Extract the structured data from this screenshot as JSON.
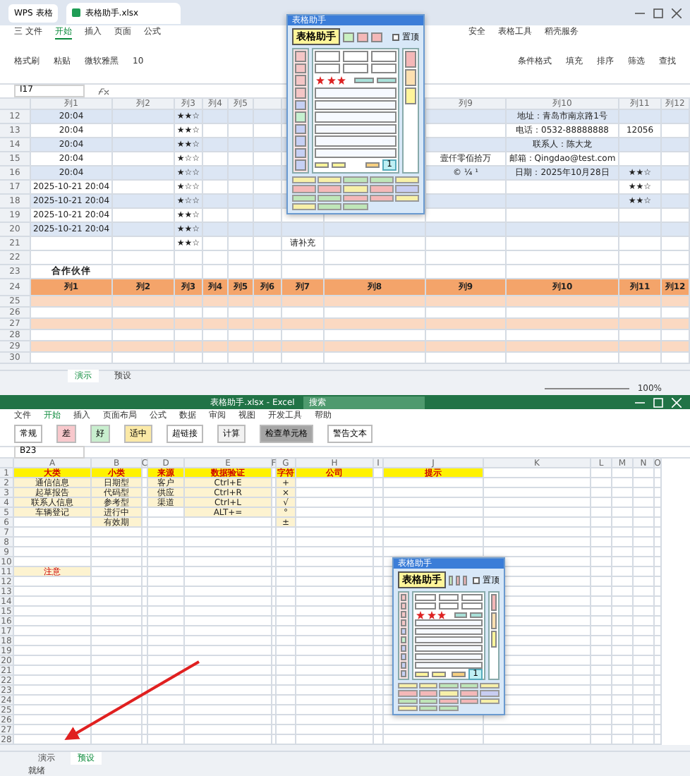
{
  "top_window": {
    "app_tab": "WPS 表格",
    "doc_tab": "表格助手.xlsx",
    "menu": [
      {
        "label": "三 文件",
        "selected": false
      },
      {
        "label": "开始",
        "selected": true
      },
      {
        "label": "插入",
        "selected": false
      },
      {
        "label": "页面",
        "selected": false
      },
      {
        "label": "公式",
        "selected": false
      }
    ],
    "menu_right": [
      {
        "label": "安全",
        "selected": false
      },
      {
        "label": "表格工具",
        "selected": false
      },
      {
        "label": "稻壳服务",
        "selected": false
      }
    ],
    "ribbon": [
      "格式刷",
      "粘贴",
      "微软雅黑",
      "10"
    ],
    "ribbon_right": [
      "条件格式",
      "填充",
      "排序",
      "筛选",
      "查找"
    ],
    "name_box": "I17",
    "columns": {
      "c1": "列1",
      "c2": "列2",
      "c3": "列3",
      "c4": "列4",
      "c5": "列5",
      "c9": "列9",
      "c10": "列10",
      "c11": "列11",
      "c12": "列12"
    },
    "rows": [
      {
        "num": "12",
        "cells": {
          "c1": "20:04",
          "c3": "★★☆",
          "c10": "地址：青岛市南京路1号"
        }
      },
      {
        "num": "13",
        "cells": {
          "c1": "20:04",
          "c3": "★★☆",
          "c10": "电话：0532-88888888",
          "c11": "12056"
        }
      },
      {
        "num": "14",
        "cells": {
          "c1": "20:04",
          "c3": "★★☆",
          "c10": "联系人：陈大龙"
        }
      },
      {
        "num": "15",
        "cells": {
          "c1": "20:04",
          "c3": "★☆☆",
          "c9": "壹仟零佰拾万",
          "c10": "邮箱：Qingdao@test.com"
        }
      },
      {
        "num": "16",
        "cells": {
          "c1": "20:04",
          "c3": "★☆☆",
          "c9": "© ¼ ¹",
          "c10": "日期：2025年10月28日",
          "c11": "★★☆"
        }
      },
      {
        "num": "17",
        "cells": {
          "c1": "2025-10-21 20:04",
          "c3": "★☆☆",
          "c11": "★★☆"
        }
      },
      {
        "num": "18",
        "cells": {
          "c1": "2025-10-21 20:04",
          "c3": "★☆☆",
          "c11": "★★☆"
        }
      },
      {
        "num": "19",
        "cells": {
          "c1": "2025-10-21 20:04",
          "c3": "★★☆"
        }
      },
      {
        "num": "20",
        "cells": {
          "c1": "2025-10-21 20:04",
          "c3": "★★☆"
        }
      },
      {
        "num": "21",
        "cells": {
          "c3": "★★☆",
          "c7": "请补充"
        }
      }
    ],
    "blank_row_num": "22",
    "section_row_num": "23",
    "header_row_num": "24",
    "partner_row_nums": [
      "25",
      "26",
      "27",
      "28",
      "29",
      "30"
    ],
    "section_title": "合作伙伴",
    "partner_columns": [
      "列1",
      "列2",
      "列3",
      "列4",
      "列5",
      "列6",
      "列7",
      "列8",
      "列9",
      "列10",
      "列11",
      "列12"
    ],
    "sheets": [
      {
        "label": "演示",
        "selected": true
      },
      {
        "label": "预设",
        "selected": false
      }
    ],
    "zoom": "100%"
  },
  "top_panel": {
    "title": "表格助手",
    "app_name": "表格助手",
    "pin": {
      "label": "置顶",
      "checked": false
    },
    "stars": 3,
    "counter": "1",
    "footer": [
      {
        "color": "#f7f0a8"
      },
      {
        "color": "#f7f0a8"
      },
      {
        "color": "#bfe6b8"
      },
      {
        "color": "#bfe6b8"
      },
      {
        "color": "#f7f0a8"
      },
      {
        "color": "#f4b8b8"
      },
      {
        "color": "#f4b8b8"
      },
      {
        "color": "#f7f0a8"
      },
      {
        "color": "#f4b8b8"
      },
      {
        "color": "#c8cdf2"
      },
      {
        "color": "#bfe6b8"
      },
      {
        "color": "#bfe6b8"
      },
      {
        "color": "#f4b8b8"
      },
      {
        "color": "#f4b8b8"
      },
      {
        "color": "#f7f0a8"
      },
      {
        "color": "#f7f0a8"
      },
      {
        "color": "#bfe6b8"
      },
      {
        "color": "#bfe6b8"
      }
    ]
  },
  "bottom_window": {
    "title": "表格助手.xlsx - Excel",
    "search": "搜索",
    "menu": [
      {
        "label": "文件",
        "selected": false
      },
      {
        "label": "开始",
        "selected": true
      },
      {
        "label": "插入",
        "selected": false
      },
      {
        "label": "页面布局",
        "selected": false
      },
      {
        "label": "公式",
        "selected": false
      },
      {
        "label": "数据",
        "selected": false
      },
      {
        "label": "审阅",
        "selected": false
      },
      {
        "label": "视图",
        "selected": false
      },
      {
        "label": "开发工具",
        "selected": false
      },
      {
        "label": "帮助",
        "selected": false
      }
    ],
    "styles": [
      {
        "label": "常规",
        "color": "#ffffff"
      },
      {
        "label": "差",
        "color": "#f8c8cc"
      },
      {
        "label": "好",
        "color": "#c8eece"
      },
      {
        "label": "适中",
        "color": "#fbe9a6"
      },
      {
        "label": "超链接",
        "color": "#ffffff"
      },
      {
        "label": "计算",
        "color": "#f2f2f2"
      },
      {
        "label": "检查单元格",
        "color": "#a5a5a5"
      },
      {
        "label": "警告文本",
        "color": "#ffffff"
      }
    ],
    "name_box": "B23",
    "columns": [
      "A",
      "B",
      "C",
      "D",
      "E",
      "F",
      "G",
      "H",
      "I",
      "J",
      "K",
      "L",
      "M",
      "N",
      "O"
    ],
    "rows": [
      {
        "num": "1",
        "cells": {
          "A": "大类",
          "B": "小类",
          "D": "来源",
          "E": "数据验证",
          "G": "字符",
          "H": "公司",
          "J": "提示"
        }
      },
      {
        "num": "2",
        "cells": {
          "A": "通信信息",
          "B": "日期型",
          "D": "客户",
          "E": "Ctrl+E",
          "G": "+"
        }
      },
      {
        "num": "3",
        "cells": {
          "A": "起草报告",
          "B": "代码型",
          "D": "供应",
          "E": "Ctrl+R",
          "G": "×"
        }
      },
      {
        "num": "4",
        "cells": {
          "A": "联系人信息",
          "B": "参考型",
          "D": "渠道",
          "E": "Ctrl+L",
          "G": "√"
        }
      },
      {
        "num": "5",
        "cells": {
          "A": "车辆登记",
          "B": "进行中",
          "E": "ALT+=",
          "G": "°"
        }
      },
      {
        "num": "6",
        "cells": {
          "B": "有效期",
          "G": "±"
        }
      },
      {
        "num": "7"
      },
      {
        "num": "8"
      },
      {
        "num": "9"
      },
      {
        "num": "10"
      },
      {
        "num": "11",
        "cells": {
          "A": "注意"
        }
      },
      {
        "num": "12"
      },
      {
        "num": "13"
      },
      {
        "num": "14"
      },
      {
        "num": "15"
      },
      {
        "num": "16"
      },
      {
        "num": "17"
      },
      {
        "num": "18"
      },
      {
        "num": "19"
      },
      {
        "num": "20"
      },
      {
        "num": "21"
      },
      {
        "num": "22"
      },
      {
        "num": "23"
      },
      {
        "num": "24"
      },
      {
        "num": "25"
      },
      {
        "num": "26"
      },
      {
        "num": "27"
      },
      {
        "num": "28"
      }
    ],
    "sheets": [
      {
        "label": "演示",
        "selected": false
      },
      {
        "label": "预设",
        "selected": true
      }
    ],
    "status": "就绪"
  },
  "bottom_panel": {
    "title": "表格助手",
    "app_name": "表格助手",
    "pin": {
      "label": "置顶",
      "checked": false
    },
    "stars": 3,
    "counter": "1",
    "footer": [
      {
        "color": "#f7f0a8"
      },
      {
        "color": "#f7f0a8"
      },
      {
        "color": "#bfe6b8"
      },
      {
        "color": "#bfe6b8"
      },
      {
        "color": "#f7f0a8"
      },
      {
        "color": "#f4b8b8"
      },
      {
        "color": "#f4b8b8"
      },
      {
        "color": "#f7f0a8"
      },
      {
        "color": "#f4b8b8"
      },
      {
        "color": "#c8cdf2"
      },
      {
        "color": "#bfe6b8"
      },
      {
        "color": "#bfe6b8"
      },
      {
        "color": "#f4b8b8"
      },
      {
        "color": "#f4b8b8"
      },
      {
        "color": "#f7f0a8"
      },
      {
        "color": "#f7f0a8"
      },
      {
        "color": "#bfe6b8"
      },
      {
        "color": "#bfe6b8"
      }
    ]
  }
}
